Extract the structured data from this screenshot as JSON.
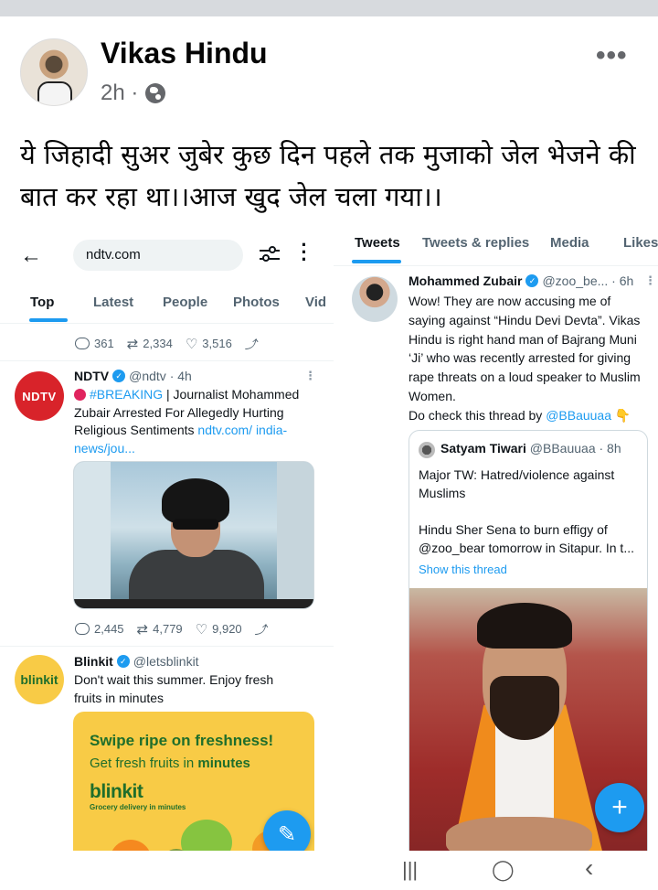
{
  "post": {
    "author": "Vikas Hindu",
    "time": "2h ·",
    "more": "•••",
    "text": "ये जिहादी सुअर जुबेर कुछ दिन पहले तक मुजाको जेल भेजने की बात कर रहा था।।आज खुद जेल चला गया।।"
  },
  "left": {
    "back": "←",
    "search_value": "ndtv.com",
    "tabs": [
      "Top",
      "Latest",
      "People",
      "Photos",
      "Vid"
    ],
    "prev_stats": {
      "replies": "361",
      "retweets": "2,334",
      "likes": "3,516"
    },
    "ndtv": {
      "avatar": "NDTV",
      "name": "NDTV",
      "handle": "@ndtv · 4h",
      "breaking": "#BREAKING",
      "text": " | Journalist Mohammed Zubair Arrested For Allegedly Hurting Religious Sentiments ",
      "link": "ndtv.com/ india-news/jou...",
      "replies": "2,445",
      "retweets": "4,779",
      "likes": "9,920"
    },
    "blinkit": {
      "avatar": "blinkit",
      "name": "Blinkit",
      "handle": "@letsblinkit",
      "text": "Don't wait this summer. Enjoy fresh fruits in minutes",
      "ad_headline": "Swipe ripe on freshness!",
      "ad_sub_prefix": "Get fresh fruits in ",
      "ad_sub_bold": "minutes",
      "ad_logo": "blinkit",
      "ad_tagline": "Grocery delivery in minutes"
    }
  },
  "right": {
    "tabs": [
      "Tweets",
      "Tweets & replies",
      "Media",
      "Likes"
    ],
    "tweet": {
      "name": "Mohammed Zubair",
      "handle": "@zoo_be... · 6h",
      "text": "Wow! They are now accusing me of saying against “Hindu Devi Devta”. Vikas Hindu is right hand man of Bajrang Muni ‘Ji’ who was recently arrested for giving rape threats on a loud speaker to Muslim Women.",
      "check_prefix": "Do check this thread by ",
      "check_mention": "@BBauuaa",
      "check_emoji": "👇"
    },
    "quote": {
      "name": "Satyam Tiwari",
      "handle": "@BBauuaa · 8h",
      "line1": "Major TW: Hatred/violence against Muslims",
      "line2": "Hindu Sher Sena to burn effigy of @zoo_bear tomorrow in Sitapur. In t...",
      "show_thread": "Show this thread"
    }
  },
  "nav": {
    "recents": "|||",
    "home": "◯",
    "back": "‹"
  },
  "colors": {
    "twitter_blue": "#1d9bf0",
    "ndtv_red": "#d8232a",
    "blinkit_yellow": "#f8cb46",
    "blinkit_green": "#1f6e2b"
  }
}
